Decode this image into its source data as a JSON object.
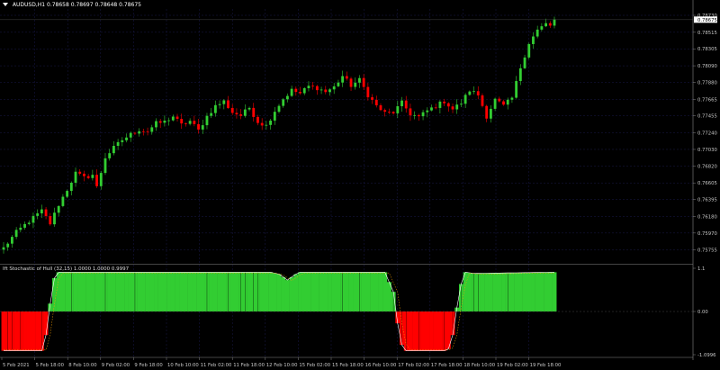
{
  "window": {
    "symbol_title": "AUDUSD,H1  0.78658 0.78697 0.78648 0.78675",
    "indicator_title": "Ift Stochastic of Hull (32,15) 1.0000 1.0000 0.9997"
  },
  "colors": {
    "background": "#000000",
    "grid": "#1a1a4a",
    "bull": "#32cd32",
    "bear": "#ff0000",
    "axis_text": "#c8c8c8",
    "current_price_bg": "#ffffff"
  },
  "price_axis": {
    "labels": [
      "0.78730",
      "0.78515",
      "0.78305",
      "0.78090",
      "0.77880",
      "0.77665",
      "0.77455",
      "0.77240",
      "0.77030",
      "0.76820",
      "0.76605",
      "0.76395",
      "0.76180",
      "0.75970",
      "0.75755"
    ],
    "current_price": "0.78675"
  },
  "indicator_axis": {
    "labels": [
      "1.1",
      "0.00",
      "-1.0996"
    ]
  },
  "time_axis": {
    "labels": [
      "5 Feb 2021",
      "5 Feb 18:00",
      "8 Feb 10:00",
      "9 Feb 02:00",
      "9 Feb 18:00",
      "10 Feb 10:00",
      "11 Feb 02:00",
      "11 Feb 18:00",
      "12 Feb 10:00",
      "15 Feb 02:00",
      "15 Feb 18:00",
      "16 Feb 10:00",
      "17 Feb 02:00",
      "17 Feb 18:00",
      "18 Feb 10:00",
      "19 Feb 02:00",
      "19 Feb 18:00"
    ]
  },
  "chart_data": [
    {
      "type": "candlestick",
      "title": "AUDUSD,H1",
      "y_range": [
        0.7566,
        0.7881
      ],
      "close_path": [
        [
          0,
          0.7578
        ],
        [
          3,
          0.7598
        ],
        [
          6,
          0.7612
        ],
        [
          9,
          0.7625
        ],
        [
          11,
          0.7609
        ],
        [
          13,
          0.7633
        ],
        [
          15,
          0.7652
        ],
        [
          17,
          0.7673
        ],
        [
          19,
          0.7667
        ],
        [
          21,
          0.7671
        ],
        [
          22,
          0.7655
        ],
        [
          24,
          0.7693
        ],
        [
          26,
          0.7705
        ],
        [
          28,
          0.7715
        ],
        [
          30,
          0.7722
        ],
        [
          32,
          0.7728
        ],
        [
          34,
          0.7726
        ],
        [
          36,
          0.7736
        ],
        [
          38,
          0.7738
        ],
        [
          40,
          0.7745
        ],
        [
          42,
          0.7734
        ],
        [
          44,
          0.7739
        ],
        [
          46,
          0.7727
        ],
        [
          48,
          0.7745
        ],
        [
          50,
          0.7758
        ],
        [
          52,
          0.7764
        ],
        [
          54,
          0.775
        ],
        [
          56,
          0.7746
        ],
        [
          58,
          0.7756
        ],
        [
          60,
          0.7738
        ],
        [
          62,
          0.7733
        ],
        [
          64,
          0.7752
        ],
        [
          66,
          0.7767
        ],
        [
          68,
          0.7778
        ],
        [
          70,
          0.7774
        ],
        [
          72,
          0.7783
        ],
        [
          74,
          0.7781
        ],
        [
          76,
          0.7776
        ],
        [
          78,
          0.7782
        ],
        [
          80,
          0.7796
        ],
        [
          82,
          0.7784
        ],
        [
          84,
          0.7791
        ],
        [
          86,
          0.7772
        ],
        [
          88,
          0.7758
        ],
        [
          90,
          0.7749
        ],
        [
          92,
          0.775
        ],
        [
          94,
          0.7762
        ],
        [
          96,
          0.7748
        ],
        [
          98,
          0.7744
        ],
        [
          100,
          0.7752
        ],
        [
          102,
          0.7758
        ],
        [
          104,
          0.7764
        ],
        [
          106,
          0.7754
        ],
        [
          108,
          0.7762
        ],
        [
          110,
          0.7778
        ],
        [
          112,
          0.7772
        ],
        [
          114,
          0.7745
        ],
        [
          116,
          0.7766
        ],
        [
          118,
          0.7758
        ],
        [
          120,
          0.7768
        ],
        [
          122,
          0.7807
        ],
        [
          124,
          0.7838
        ],
        [
          126,
          0.7854
        ],
        [
          128,
          0.7862
        ],
        [
          129,
          0.786
        ],
        [
          130,
          0.7867
        ]
      ]
    },
    {
      "type": "histogram",
      "title": "Ift Stochastic of Hull (32,15)",
      "y_range": [
        -1.0996,
        1.1
      ],
      "values_path": [
        [
          0,
          -1.0
        ],
        [
          9,
          -1.0
        ],
        [
          10,
          -0.6
        ],
        [
          11,
          0.2
        ],
        [
          12,
          0.85
        ],
        [
          13,
          1.0
        ],
        [
          62,
          1.0
        ],
        [
          63,
          1.0
        ],
        [
          65,
          0.95
        ],
        [
          67,
          0.8
        ],
        [
          69,
          0.95
        ],
        [
          70,
          1.0
        ],
        [
          90,
          1.0
        ],
        [
          92,
          0.5
        ],
        [
          93,
          -0.3
        ],
        [
          94,
          -0.85
        ],
        [
          95,
          -1.0
        ],
        [
          104,
          -1.0
        ],
        [
          105,
          -0.95
        ],
        [
          106,
          -0.6
        ],
        [
          107,
          0.1
        ],
        [
          108,
          0.7
        ],
        [
          109,
          1.0
        ],
        [
          111,
          0.97
        ],
        [
          130,
          1.0
        ]
      ]
    }
  ]
}
